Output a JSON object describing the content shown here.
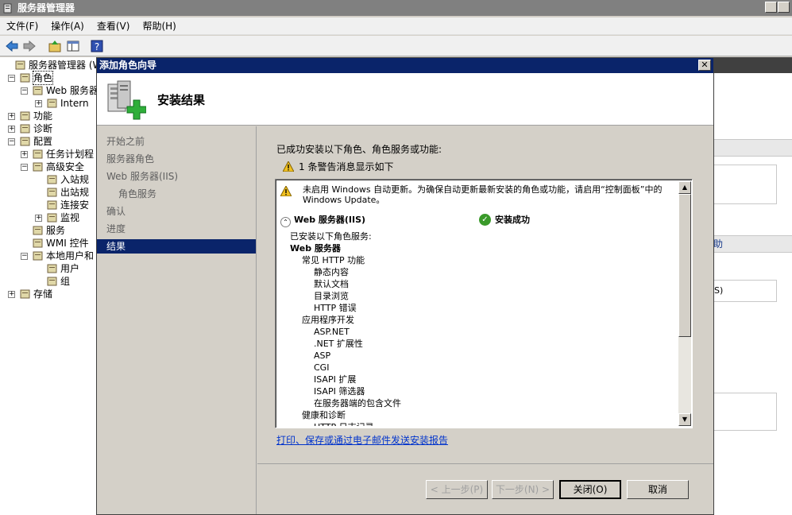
{
  "window": {
    "title": "服务器管理器"
  },
  "menu": [
    "文件(F)",
    "操作(A)",
    "查看(V)",
    "帮助(H)"
  ],
  "tree": [
    {
      "label": "服务器管理器 (WI",
      "depth": 0,
      "exp": ""
    },
    {
      "label": "角色",
      "depth": 1,
      "exp": "−"
    },
    {
      "label": "Web 服务器",
      "depth": 2,
      "exp": "−"
    },
    {
      "label": "Intern",
      "depth": 3,
      "exp": "+"
    },
    {
      "label": "功能",
      "depth": 1,
      "exp": "+"
    },
    {
      "label": "诊断",
      "depth": 1,
      "exp": "+"
    },
    {
      "label": "配置",
      "depth": 1,
      "exp": "−"
    },
    {
      "label": "任务计划程",
      "depth": 2,
      "exp": "+"
    },
    {
      "label": "高级安全",
      "depth": 2,
      "exp": "−"
    },
    {
      "label": "入站规",
      "depth": 3,
      "exp": ""
    },
    {
      "label": "出站规",
      "depth": 3,
      "exp": ""
    },
    {
      "label": "连接安",
      "depth": 3,
      "exp": ""
    },
    {
      "label": "监视",
      "depth": 3,
      "exp": "+"
    },
    {
      "label": "服务",
      "depth": 2,
      "exp": ""
    },
    {
      "label": "WMI 控件",
      "depth": 2,
      "exp": ""
    },
    {
      "label": "本地用户和",
      "depth": 2,
      "exp": "−"
    },
    {
      "label": "用户",
      "depth": 3,
      "exp": ""
    },
    {
      "label": "组",
      "depth": 3,
      "exp": ""
    },
    {
      "label": "存储",
      "depth": 1,
      "exp": "+"
    }
  ],
  "right_pane": {
    "text1": "助",
    "text2": "S)"
  },
  "dialog": {
    "title": "添加角色向导",
    "heading": "安装结果",
    "nav": [
      {
        "label": "开始之前",
        "sub": false,
        "active": false
      },
      {
        "label": "服务器角色",
        "sub": false,
        "active": false
      },
      {
        "label": "Web 服务器(IIS)",
        "sub": false,
        "active": false
      },
      {
        "label": "角色服务",
        "sub": true,
        "active": false
      },
      {
        "label": "确认",
        "sub": false,
        "active": false
      },
      {
        "label": "进度",
        "sub": false,
        "active": false
      },
      {
        "label": "结果",
        "sub": false,
        "active": true
      }
    ],
    "intro": "已成功安装以下角色、角色服务或功能:",
    "warning_count": "1 条警告消息显示如下",
    "warning_message": "未启用 Windows 自动更新。为确保自动更新最新安装的角色或功能，请启用“控制面板”中的 Windows Update。",
    "role_name": "Web 服务器(IIS)",
    "status": "安装成功",
    "services": [
      {
        "label": "已安装以下角色服务:",
        "indent": 0,
        "bold": false
      },
      {
        "label": "Web 服务器",
        "indent": 0,
        "bold": true
      },
      {
        "label": "常见 HTTP 功能",
        "indent": 1,
        "bold": false
      },
      {
        "label": "静态内容",
        "indent": 2,
        "bold": false
      },
      {
        "label": "默认文档",
        "indent": 2,
        "bold": false
      },
      {
        "label": "目录浏览",
        "indent": 2,
        "bold": false
      },
      {
        "label": "HTTP 错误",
        "indent": 2,
        "bold": false
      },
      {
        "label": "应用程序开发",
        "indent": 1,
        "bold": false
      },
      {
        "label": "ASP.NET",
        "indent": 2,
        "bold": false
      },
      {
        "label": ".NET 扩展性",
        "indent": 2,
        "bold": false
      },
      {
        "label": "ASP",
        "indent": 2,
        "bold": false
      },
      {
        "label": "CGI",
        "indent": 2,
        "bold": false
      },
      {
        "label": "ISAPI 扩展",
        "indent": 2,
        "bold": false
      },
      {
        "label": "ISAPI 筛选器",
        "indent": 2,
        "bold": false
      },
      {
        "label": "在服务器端的包含文件",
        "indent": 2,
        "bold": false
      },
      {
        "label": "健康和诊断",
        "indent": 1,
        "bold": false
      },
      {
        "label": "HTTP 日志记录",
        "indent": 2,
        "bold": false
      }
    ],
    "report_link": "打印、保存或通过电子邮件发送安装报告",
    "buttons": {
      "prev": "< 上一步(P)",
      "next": "下一步(N) >",
      "close": "关闭(O)",
      "cancel": "取消"
    }
  }
}
